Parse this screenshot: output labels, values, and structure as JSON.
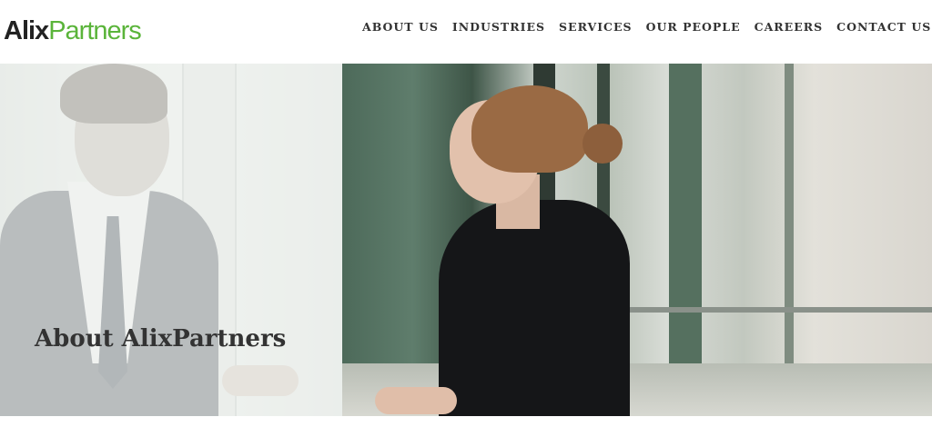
{
  "header": {
    "logo": {
      "part1": "Alix",
      "part2": "Partners"
    },
    "nav": [
      {
        "label": "ABOUT US"
      },
      {
        "label": "INDUSTRIES"
      },
      {
        "label": "SERVICES"
      },
      {
        "label": "OUR PEOPLE"
      },
      {
        "label": "CAREERS"
      },
      {
        "label": "CONTACT US"
      }
    ]
  },
  "hero": {
    "title": "About AlixPartners"
  },
  "colors": {
    "brand_green": "#5ab43a",
    "logo_dark": "#222222",
    "nav_text": "#333333"
  }
}
